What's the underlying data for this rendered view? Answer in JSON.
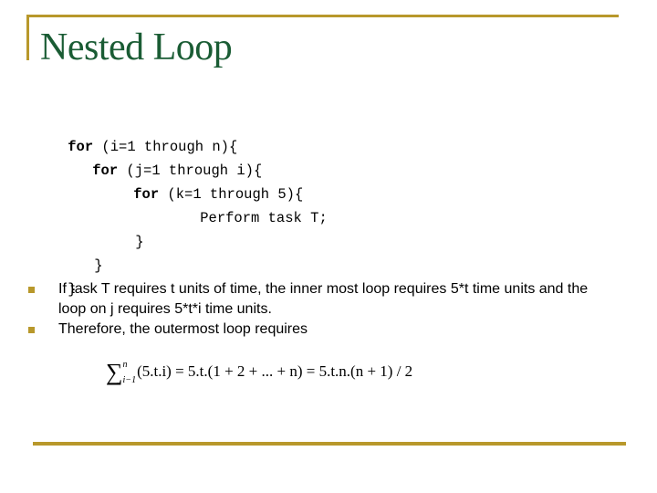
{
  "slide": {
    "title": "Nested Loop",
    "accent_color": "#b8982b",
    "title_color": "#1a5c34"
  },
  "code": {
    "lines": [
      {
        "keyword": "for",
        "rest": " (i=1 through n){"
      },
      {
        "keyword": "for",
        "rest": " (j=1 through i){"
      },
      {
        "keyword": "for",
        "rest": " (k=1 through 5){"
      },
      {
        "keyword": "",
        "rest": "Perform task T;"
      },
      {
        "keyword": "",
        "rest": "}"
      },
      {
        "keyword": "",
        "rest": "}"
      },
      {
        "keyword": "",
        "rest": "}"
      }
    ]
  },
  "bullets": [
    {
      "text": "If task T requires t units of time, the inner most loop requires 5*t time units and the loop on j requires 5*t*i time units."
    },
    {
      "text": "Therefore, the outermost loop requires"
    }
  ],
  "formula": {
    "sigma": "∑",
    "upper_limit": "n",
    "lower_limit": "i−1",
    "body": "(5.t.i) = 5.t.(1 + 2 + ... + n) = 5.t.n.(n + 1) / 2"
  }
}
